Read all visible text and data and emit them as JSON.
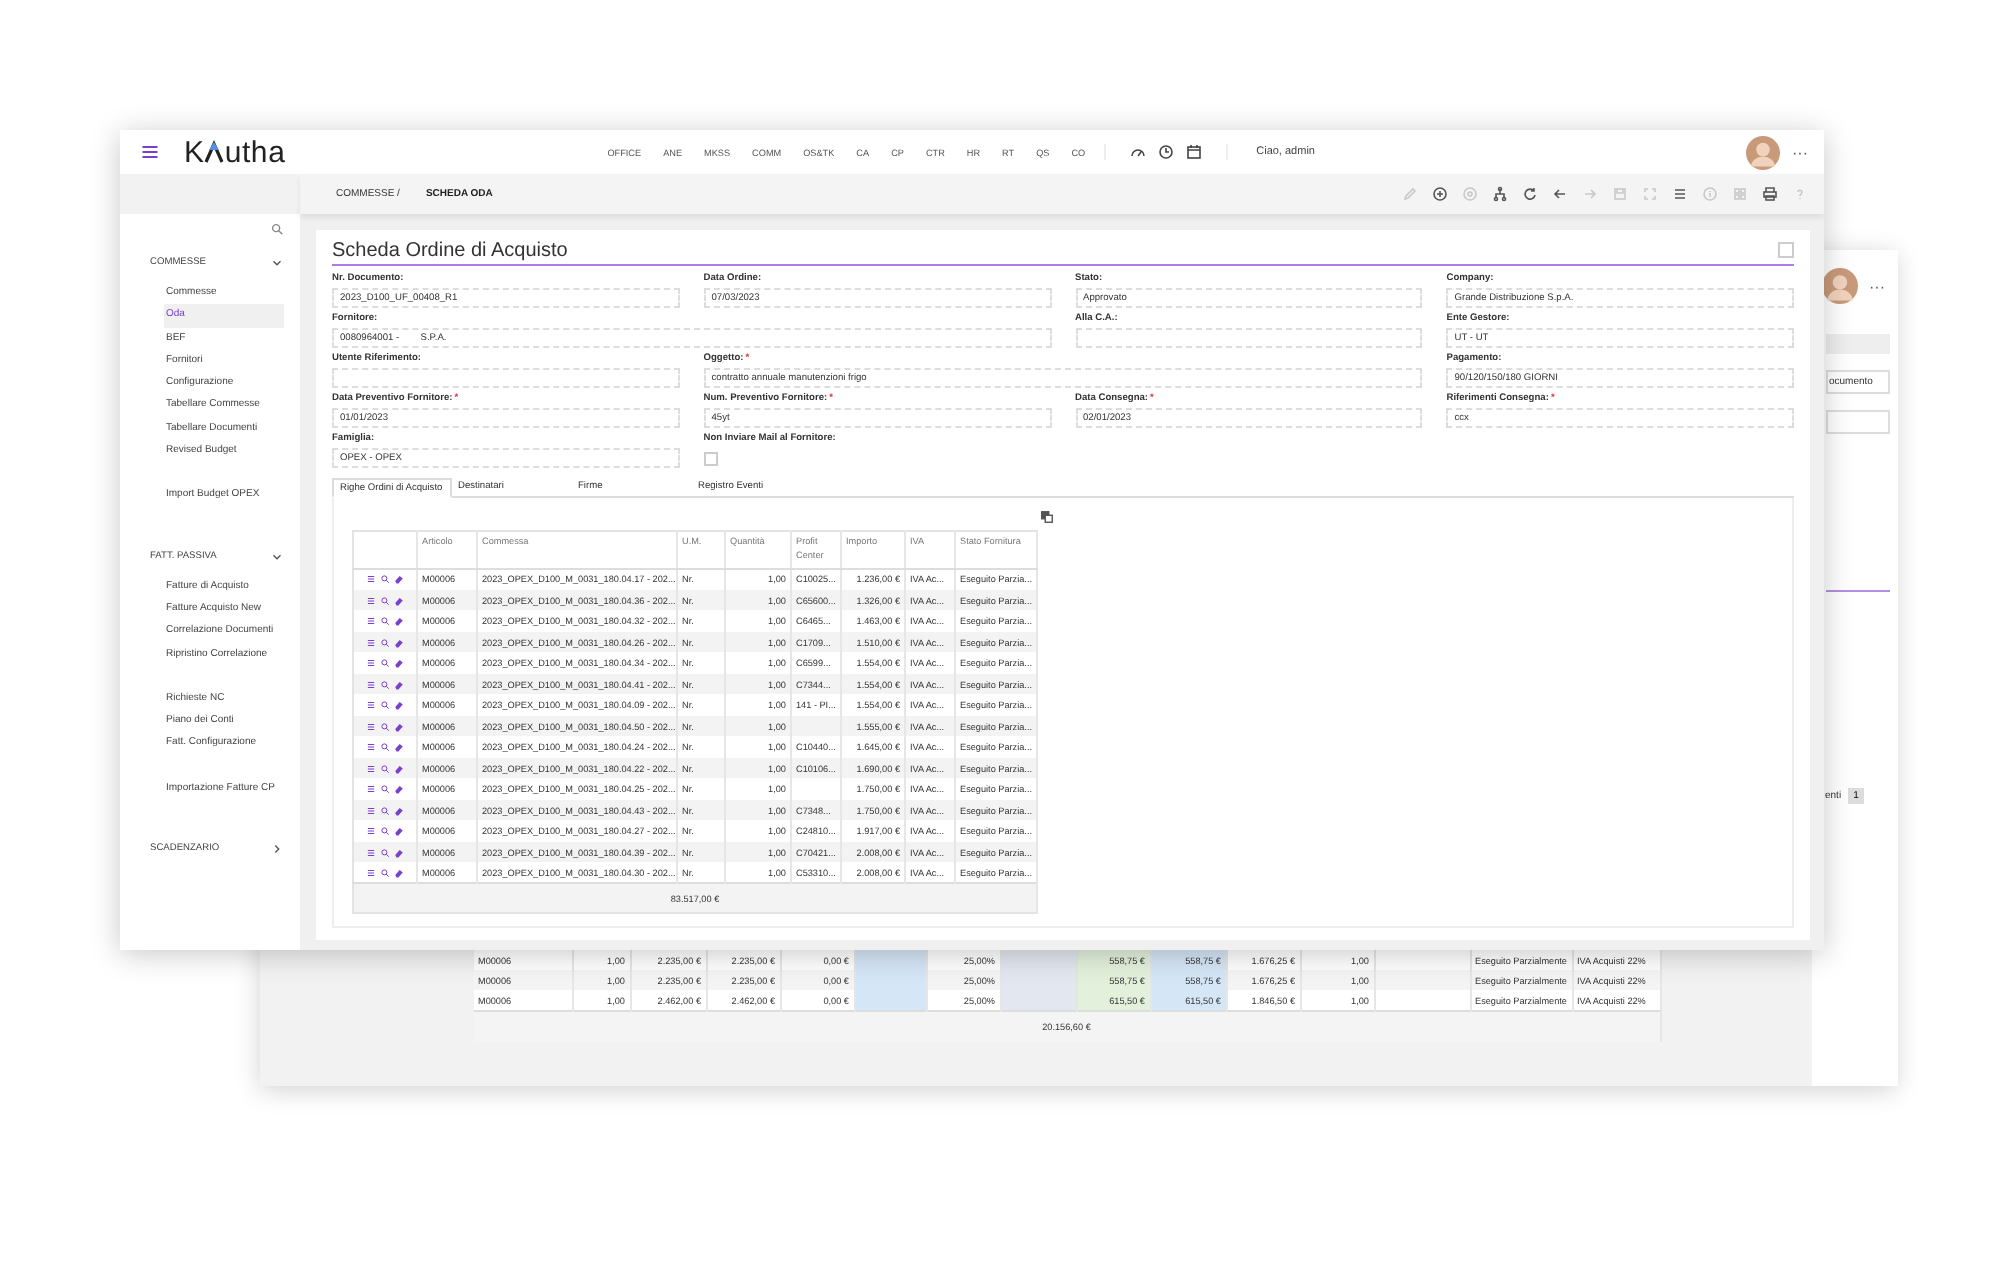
{
  "back_window": {
    "more": "···",
    "side_text": "ocumento",
    "pager_text": "enti",
    "page": "1",
    "rows": [
      {
        "cells": [
          "M00006",
          "1,00",
          "2.235,00 €",
          "2.235,00 €",
          "0,00 €",
          "",
          "25,00%",
          "",
          "558,75 €",
          "558,75 €",
          "1.676,25 €",
          "1,00",
          "",
          "Eseguito Parzialmente",
          "IVA Acquisti 22%"
        ]
      },
      {
        "cells": [
          "M00006",
          "1,00",
          "2.235,00 €",
          "2.235,00 €",
          "0,00 €",
          "",
          "25,00%",
          "",
          "558,75 €",
          "558,75 €",
          "1.676,25 €",
          "1,00",
          "",
          "Eseguito Parzialmente",
          "IVA Acquisti 22%"
        ]
      },
      {
        "cells": [
          "M00006",
          "1,00",
          "2.462,00 €",
          "2.462,00 €",
          "0,00 €",
          "",
          "25,00%",
          "",
          "615,50 €",
          "615,50 €",
          "1.846,50 €",
          "1,00",
          "",
          "Eseguito Parzialmente",
          "IVA Acquisti 22%"
        ]
      }
    ],
    "total": "20.156,60 €"
  },
  "topbar": {
    "logo": [
      "K",
      "utha"
    ],
    "modules": [
      "OFFICE",
      "ANE",
      "MKSS",
      "COMM",
      "OS&TK",
      "CA",
      "CP",
      "CTR",
      "HR",
      "RT",
      "QS",
      "CO"
    ],
    "greeting": "Ciao, admin",
    "more": "···"
  },
  "breadcrumb": [
    "COMMESSE /",
    "SCHEDA ODA"
  ],
  "toolbar": [
    {
      "disabled": true
    },
    {
      "disabled": false
    },
    {
      "disabled": true
    },
    {
      "disabled": false
    },
    {
      "disabled": false
    },
    {
      "disabled": false
    },
    {
      "disabled": true
    },
    {
      "disabled": true
    },
    {
      "disabled": true
    },
    {
      "disabled": false
    },
    {
      "disabled": true
    },
    {
      "disabled": true
    },
    {
      "disabled": false
    },
    {
      "disabled": true
    }
  ],
  "sidebar": {
    "sections": [
      {
        "title": "COMMESSE",
        "expanded": true,
        "groups": [
          [
            {
              "label": "Commesse",
              "selected": false
            },
            {
              "label": "Oda",
              "selected": true
            },
            {
              "label": "BEF",
              "selected": false
            },
            {
              "label": "Fornitori",
              "selected": false
            },
            {
              "label": "Configurazione",
              "selected": false
            },
            {
              "label": "Tabellare Commesse",
              "selected": false
            },
            {
              "label": "Tabellare Documenti",
              "selected": false
            },
            {
              "label": "Revised Budget",
              "selected": false
            }
          ],
          [
            {
              "label": "Import Budget OPEX",
              "selected": false
            }
          ]
        ]
      },
      {
        "title": "FATT. PASSIVA",
        "expanded": true,
        "groups": [
          [
            {
              "label": "Fatture di Acquisto",
              "selected": false
            },
            {
              "label": "Fatture Acquisto New",
              "selected": false
            },
            {
              "label": "Correlazione Documenti",
              "selected": false
            },
            {
              "label": "Ripristino Correlazione",
              "selected": false
            }
          ],
          [
            {
              "label": "Richieste NC",
              "selected": false
            },
            {
              "label": "Piano dei Conti",
              "selected": false
            },
            {
              "label": "Fatt. Configurazione",
              "selected": false
            }
          ],
          [
            {
              "label": "Importazione Fatture CP",
              "selected": false
            }
          ]
        ]
      },
      {
        "title": "SCADENZARIO",
        "expanded": false
      }
    ]
  },
  "form": {
    "title": "Scheda Ordine di Acquisto",
    "fields": [
      {
        "kind": "text",
        "label": "Nr. Documento:",
        "value": "2023_D100_UF_00408_R1"
      },
      {
        "kind": "text",
        "label": "Data Ordine:",
        "value": "07/03/2023"
      },
      {
        "kind": "text",
        "label": "Stato:",
        "value": "Approvato"
      },
      {
        "kind": "text",
        "label": "Company:",
        "value": "Grande Distribuzione S.p.A."
      },
      {
        "kind": "text",
        "label": "Fornitore:",
        "value": "0080964001 -        S.P.A."
      },
      {
        "kind": "text",
        "label": "Alla C.A.:"
      },
      {
        "kind": "text",
        "label": "Ente Gestore:",
        "value": "UT - UT"
      },
      {
        "kind": "text",
        "label": "Utente Riferimento:"
      },
      {
        "kind": "text",
        "label": "Oggetto:",
        "required_mark": "*",
        "value": "contratto annuale manutenzioni frigo"
      },
      {
        "kind": "text",
        "label": "Pagamento:",
        "value": "90/120/150/180 GIORNI"
      },
      {
        "kind": "text",
        "label": "Data Preventivo Fornitore:",
        "required_mark": "*",
        "value": "01/01/2023"
      },
      {
        "kind": "text",
        "label": "Num. Preventivo Fornitore:",
        "required_mark": "*",
        "value": "45yt"
      },
      {
        "kind": "text",
        "label": "Data Consegna:",
        "required_mark": "*",
        "value": "02/01/2023"
      },
      {
        "kind": "text",
        "label": "Riferimenti Consegna:",
        "required_mark": "*",
        "value": "ccx"
      },
      {
        "kind": "text",
        "label": "Famiglia:",
        "value": "OPEX - OPEX"
      },
      {
        "kind": "checkbox",
        "label": "Non Inviare Mail al Fornitore:",
        "checked": false
      }
    ]
  },
  "tabs": [
    {
      "label": "Righe Ordini di Acquisto",
      "selected": true
    },
    {
      "label": "Destinatari",
      "selected": false
    },
    {
      "label": "Firme",
      "selected": false
    },
    {
      "label": "Registro Eventi",
      "selected": false
    }
  ],
  "table": {
    "columns": [
      "Articolo",
      "Commessa",
      "U.M.",
      "Quantità",
      "Profit Center",
      "Importo",
      "IVA",
      "Stato Fornitura"
    ],
    "rows": [
      {
        "cells": [
          "M00006",
          "2023_OPEX_D100_M_0031_180.04.17 - 202...",
          "Nr.",
          "1,00",
          "C10025...",
          "1.236,00 €",
          "IVA Ac...",
          "Eseguito Parzia..."
        ]
      },
      {
        "cells": [
          "M00006",
          "2023_OPEX_D100_M_0031_180.04.36 - 202...",
          "Nr.",
          "1,00",
          "C65600...",
          "1.326,00 €",
          "IVA Ac...",
          "Eseguito Parzia..."
        ]
      },
      {
        "cells": [
          "M00006",
          "2023_OPEX_D100_M_0031_180.04.32 - 202...",
          "Nr.",
          "1,00",
          "C6465...",
          "1.463,00 €",
          "IVA Ac...",
          "Eseguito Parzia..."
        ]
      },
      {
        "cells": [
          "M00006",
          "2023_OPEX_D100_M_0031_180.04.26 - 202...",
          "Nr.",
          "1,00",
          "C1709...",
          "1.510,00 €",
          "IVA Ac...",
          "Eseguito Parzia..."
        ]
      },
      {
        "cells": [
          "M00006",
          "2023_OPEX_D100_M_0031_180.04.34 - 202...",
          "Nr.",
          "1,00",
          "C6599...",
          "1.554,00 €",
          "IVA Ac...",
          "Eseguito Parzia..."
        ]
      },
      {
        "cells": [
          "M00006",
          "2023_OPEX_D100_M_0031_180.04.41 - 202...",
          "Nr.",
          "1,00",
          "C7344...",
          "1.554,00 €",
          "IVA Ac...",
          "Eseguito Parzia..."
        ]
      },
      {
        "cells": [
          "M00006",
          "2023_OPEX_D100_M_0031_180.04.09 - 202...",
          "Nr.",
          "1,00",
          "141 - PI...",
          "1.554,00 €",
          "IVA Ac...",
          "Eseguito Parzia..."
        ]
      },
      {
        "cells": [
          "M00006",
          "2023_OPEX_D100_M_0031_180.04.50 - 202...",
          "Nr.",
          "1,00",
          "",
          "1.555,00 €",
          "IVA Ac...",
          "Eseguito Parzia..."
        ]
      },
      {
        "cells": [
          "M00006",
          "2023_OPEX_D100_M_0031_180.04.24 - 202...",
          "Nr.",
          "1,00",
          "C10440...",
          "1.645,00 €",
          "IVA Ac...",
          "Eseguito Parzia..."
        ]
      },
      {
        "cells": [
          "M00006",
          "2023_OPEX_D100_M_0031_180.04.22 - 202...",
          "Nr.",
          "1,00",
          "C10106...",
          "1.690,00 €",
          "IVA Ac...",
          "Eseguito Parzia..."
        ]
      },
      {
        "cells": [
          "M00006",
          "2023_OPEX_D100_M_0031_180.04.25 - 202...",
          "Nr.",
          "1,00",
          "",
          "1.750,00 €",
          "IVA Ac...",
          "Eseguito Parzia..."
        ]
      },
      {
        "cells": [
          "M00006",
          "2023_OPEX_D100_M_0031_180.04.43 - 202...",
          "Nr.",
          "1,00",
          "C7348...",
          "1.750,00 €",
          "IVA Ac...",
          "Eseguito Parzia..."
        ]
      },
      {
        "cells": [
          "M00006",
          "2023_OPEX_D100_M_0031_180.04.27 - 202...",
          "Nr.",
          "1,00",
          "C24810...",
          "1.917,00 €",
          "IVA Ac...",
          "Eseguito Parzia..."
        ]
      },
      {
        "cells": [
          "M00006",
          "2023_OPEX_D100_M_0031_180.04.39 - 202...",
          "Nr.",
          "1,00",
          "C70421...",
          "2.008,00 €",
          "IVA Ac...",
          "Eseguito Parzia..."
        ]
      },
      {
        "cells": [
          "M00006",
          "2023_OPEX_D100_M_0031_180.04.30 - 202...",
          "Nr.",
          "1,00",
          "C53310...",
          "2.008,00 €",
          "IVA Ac...",
          "Eseguito Parzia..."
        ]
      }
    ],
    "total": "83.517,00 €"
  }
}
